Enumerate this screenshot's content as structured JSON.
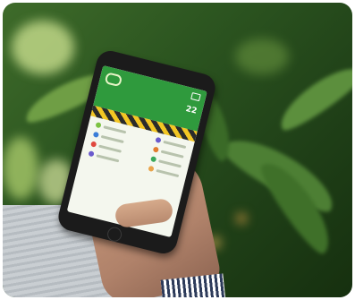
{
  "scene": {
    "description_free": true,
    "colors": {
      "foliage_dark": "#1f3f17",
      "foliage_light": "#9fc36b",
      "app_green": "#2f9a3d",
      "banner_yellow": "#f3c623",
      "skin": "#c99a7c",
      "sleeve": "#c9ced2"
    }
  },
  "phone_app": {
    "balance_text": "22"
  },
  "icons": {
    "logo": "app-logo-icon",
    "cart": "cart-icon"
  }
}
